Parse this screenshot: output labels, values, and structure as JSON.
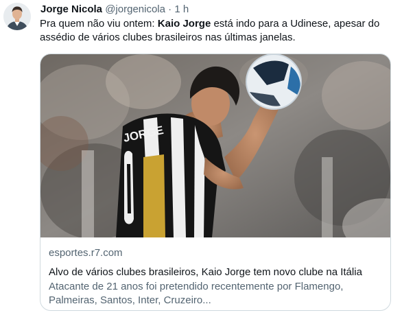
{
  "author": {
    "name": "Jorge Nicola",
    "handle": "@jorgenicola",
    "separator": "·",
    "time": "1 h"
  },
  "tweet": {
    "text_before": "Pra quem não viu ontem: ",
    "text_bold": "Kaio Jorge",
    "text_after": " está indo para a Udinese, apesar do assédio de vários clubes brasileiros nas últimas janelas."
  },
  "card": {
    "photo_text": "JORGE",
    "domain": "esportes.r7.com",
    "title": "Alvo de vários clubes brasileiros, Kaio Jorge tem novo clube na Itália",
    "description": "Atacante de 21 anos foi pretendido recentemente por Flamengo, Palmeiras, Santos, Inter, Cruzeiro..."
  },
  "colors": {
    "text_primary": "#0f1419",
    "text_secondary": "#536471",
    "border": "#cfd9de"
  }
}
